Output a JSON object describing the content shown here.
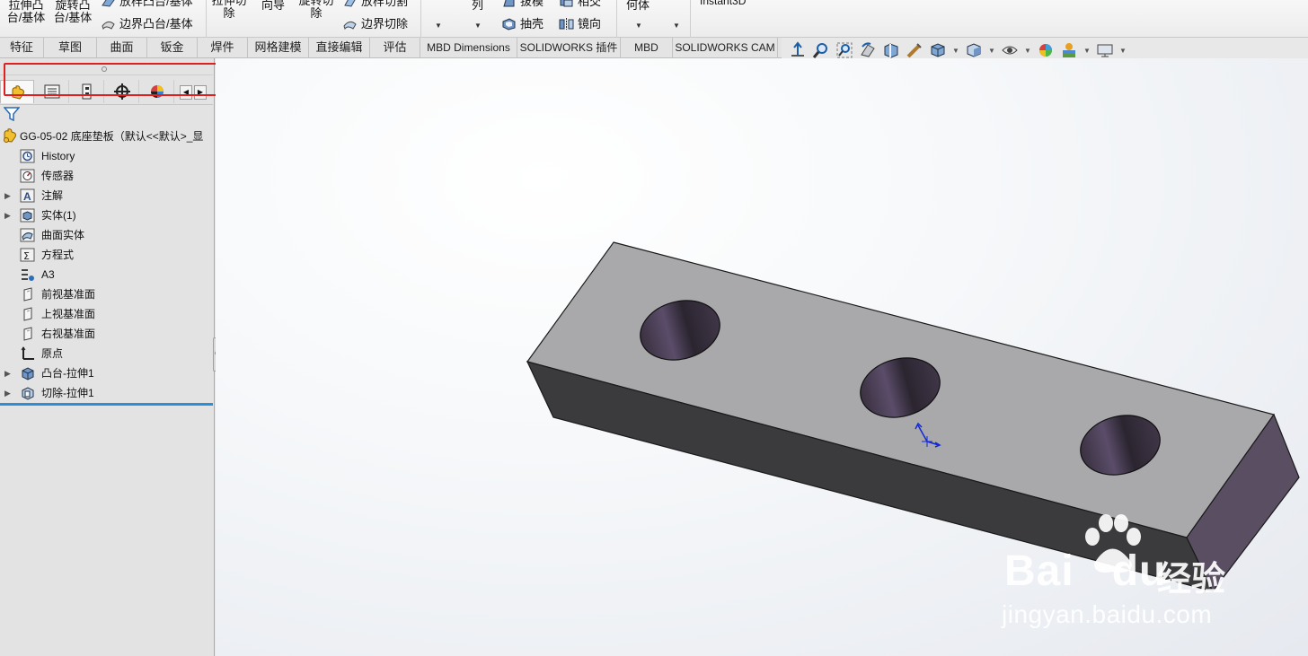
{
  "ribbon": {
    "boss_extrude_label": "拉伸凸\n台/基体",
    "revolve_boss_label": "旋转凸\n台/基体",
    "loft_boss_label": "放样凸台/基体",
    "boundary_boss_label": "边界凸台/基体",
    "extrude_cut_label": "拉伸切\n除",
    "wizard_label": "向导",
    "revolve_cut_label": "旋转切\n除",
    "loft_cut_label": "放样切割",
    "boundary_cut_label": "边界切除",
    "pattern_label": "列",
    "draft_label": "拔模",
    "intersect_label": "相交",
    "shell_label": "抽壳",
    "mirror_label": "镜向",
    "ref_geometry_label": "何体",
    "instant3d_label": "Instant3D"
  },
  "tabs": [
    {
      "label": "特征",
      "active": true
    },
    {
      "label": "草图",
      "active": false
    },
    {
      "label": "曲面",
      "active": false
    },
    {
      "label": "钣金",
      "active": false
    },
    {
      "label": "焊件",
      "active": false
    },
    {
      "label": "网格建模",
      "active": false
    },
    {
      "label": "直接编辑",
      "active": false
    },
    {
      "label": "评估",
      "active": false
    },
    {
      "label": "MBD Dimensions",
      "active": false
    },
    {
      "label": "SOLIDWORKS 插件",
      "active": false
    },
    {
      "label": "MBD",
      "active": false
    },
    {
      "label": "SOLIDWORKS CAM",
      "active": false
    }
  ],
  "panel_tabs": [
    "featuremanager-icon",
    "propertymanager-icon",
    "configurationmanager-icon",
    "dimxpertmanager-icon",
    "displaymanager-icon"
  ],
  "feature_tree": {
    "root_label": "GG-05-02 底座垫板（默认<<默认>_显",
    "items": [
      {
        "label": "History",
        "expandable": false
      },
      {
        "label": "传感器",
        "expandable": false
      },
      {
        "label": "注解",
        "expandable": true
      },
      {
        "label": "实体(1)",
        "expandable": true
      },
      {
        "label": "曲面实体",
        "expandable": false
      },
      {
        "label": "方程式",
        "expandable": false
      },
      {
        "label": "A3",
        "expandable": false
      },
      {
        "label": "前视基准面",
        "expandable": false
      },
      {
        "label": "上视基准面",
        "expandable": false
      },
      {
        "label": "右视基准面",
        "expandable": false
      },
      {
        "label": "原点",
        "expandable": false
      },
      {
        "label": "凸台-拉伸1",
        "expandable": true
      },
      {
        "label": "切除-拉伸1",
        "expandable": true
      }
    ]
  },
  "watermark": {
    "brand": "Bai",
    "brand_suffix": "du",
    "product": "经验",
    "url": "jingyan.baidu.com"
  },
  "colors": {
    "highlight_box": "#e02020",
    "rollback_bar": "#2c8ed6",
    "model_top": "#a9a9ab",
    "model_front": "#3b3b3d",
    "model_end": "#5a4f62"
  }
}
